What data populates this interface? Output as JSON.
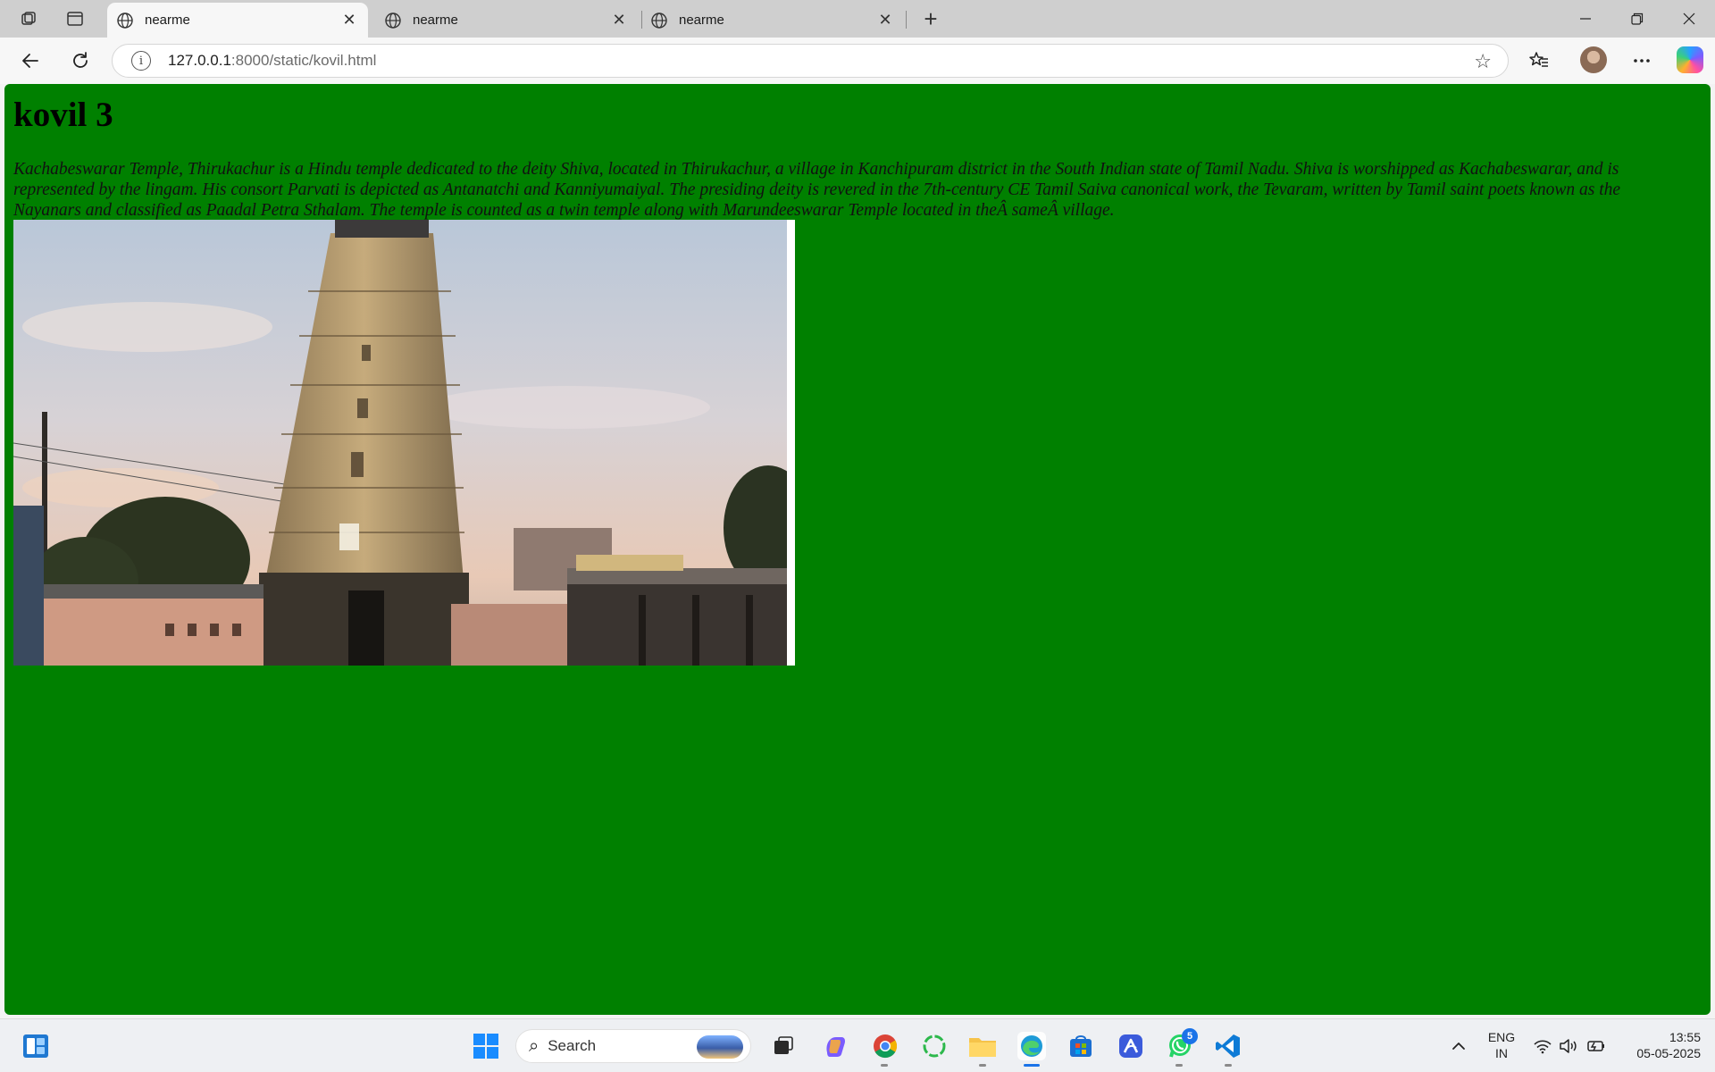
{
  "browser": {
    "tabs": [
      {
        "title": "nearme",
        "active": true
      },
      {
        "title": "nearme",
        "active": false
      },
      {
        "title": "nearme",
        "active": false
      }
    ],
    "url_host": "127.0.0.1",
    "url_path": ":8000/static/kovil.html",
    "info_glyph": "i"
  },
  "page": {
    "background_color": "#008000",
    "heading": "kovil 3",
    "paragraph": "Kachabeswarar Temple, Thirukachur is a Hindu temple dedicated to the deity Shiva, located in Thirukachur, a village in Kanchipuram district in the South Indian state of Tamil Nadu. Shiva is worshipped as Kachabeswarar, and is represented by the lingam. His consort Parvati is depicted as Antanatchi and Kanniyumaiyal. The presiding deity is revered in the 7th-century CE Tamil Saiva canonical work, the Tevaram, written by Tamil saint poets known as the Nayanars and classified as Paadal Petra Sthalam. The temple is counted as a twin temple along with Marundeeswarar Temple located in theÂ sameÂ village.",
    "image_icon": "temple-photo"
  },
  "taskbar": {
    "search_label": "Search",
    "whatsapp_badge": "5",
    "lang_top": "ENG",
    "lang_bottom": "IN",
    "time": "13:55",
    "date": "05-05-2025"
  }
}
